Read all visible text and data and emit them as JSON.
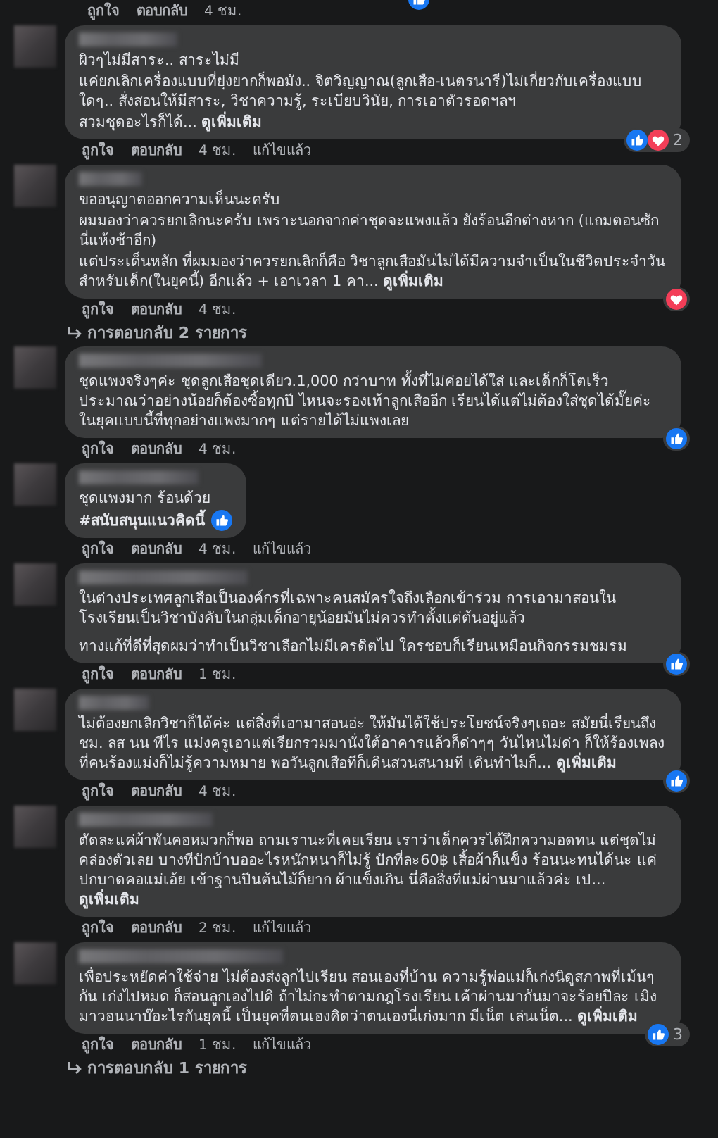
{
  "top_actions": {
    "like": "ถูกใจ",
    "reply": "ตอบกลับ",
    "time": "4 ชม.",
    "reactions": [
      {
        "kind": "like"
      }
    ]
  },
  "comments": [
    {
      "paragraphs": [
        "ผิวๆไม่มีสาระ.. สาระไม่มี",
        "แค่ยกเลิกเครื่องแบบที่ยุ่งยากก็พอมัง.. จิตวิญญาณ(ลูกเสือ-เนตรนารี)ไม่เกี่ยวกับเครื่องแบบใดๆ.. สั่งสอนให้มีสาระ, วิชาความรู้, ระเบียบวินัย, การเอาตัวรอดฯลฯ",
        "สวมชุดอะไรก็ได้..."
      ],
      "see_more": "ดูเพิ่มเติม",
      "reactions": [
        {
          "kind": "like"
        },
        {
          "kind": "love"
        }
      ],
      "reaction_count": "2",
      "like": "ถูกใจ",
      "reply": "ตอบกลับ",
      "time": "4 ชม.",
      "edited": "แก้ไขแล้ว"
    },
    {
      "paragraphs": [
        "ขออนุญาตออกความเห็นนะครับ",
        "ผมมองว่าควรยกเลิกนะครับ เพราะนอกจากค่าชุดจะแพงแล้ว ยังร้อนอีกต่างหาก (แถมตอนซักนี่แห้งช้าอีก)",
        "แต่ประเด็นหลัก ที่ผมมองว่าควรยกเลิกก็คือ วิชาลูกเสือมันไม่ได้มีความจำเป็นในชีวิตประจำวันสำหรับเด็ก(ในยุคนี้) อีกแล้ว + เอาเวลา 1 คา..."
      ],
      "see_more": "ดูเพิ่มเติม",
      "reactions": [
        {
          "kind": "love"
        }
      ],
      "like": "ถูกใจ",
      "reply": "ตอบกลับ",
      "time": "4 ชม.",
      "replies": "การตอบกลับ 2 รายการ"
    },
    {
      "paragraphs": [
        "ชุดแพงจริงๆค่ะ ชุดลูกเสือชุดเดียว.1,000 กว่าบาท ทั้งที่ไม่ค่อยได้ใส่ และเด็กก็โตเร็วประมาณว่าอย่างน้อยก็ต้องซื้อทุกปี ไหนจะรองเท้าลูกเสืออีก เรียนได้แต่ไม่ต้องใส่ชุดได้มั๊ยค่ะ ในยุคแบบนี้ที่ทุกอย่างแพงมากๆ แต่รายได้ไม่แพงเลย"
      ],
      "reactions": [
        {
          "kind": "like"
        }
      ],
      "like": "ถูกใจ",
      "reply": "ตอบกลับ",
      "time": "4 ชม."
    },
    {
      "paragraphs": [
        "ชุดแพงมาก ร้อนด้วย"
      ],
      "hashtag": "#สนับสนุนแนวคิดนี้",
      "reactions": [
        {
          "kind": "like"
        }
      ],
      "like": "ถูกใจ",
      "reply": "ตอบกลับ",
      "time": "4 ชม.",
      "edited": "แก้ไขแล้ว"
    },
    {
      "paragraphs": [
        "ในต่างประเทศลูกเสือเป็นองค์กรที่เฉพาะคนสมัครใจถึงเลือกเข้าร่วม การเอามาสอนในโรงเรียนเป็นวิชาบังคับในกลุ่มเด็กอายุน้อยมันไม่ควรทำตั้งแต่ต้นอยู่แล้ว",
        "ทางแก้ที่ดีที่สุดผมว่าทำเป็นวิชาเลือกไม่มีเครดิตไป ใครชอบก็เรียนเหมือนกิจกรรมชมรม"
      ],
      "reactions": [
        {
          "kind": "like"
        }
      ],
      "like": "ถูกใจ",
      "reply": "ตอบกลับ",
      "time": "1 ชม."
    },
    {
      "paragraphs": [
        "ไม่ต้องยกเลิกวิชาก็ได้ค่ะ แต่สิ่งที่เอามาสอนอ่ะ ให้มันได้ใช้ประโยชน์จริงๆเถอะ สมัยนี่เรียนถึงชม. ลส นน ทีไร แม่งครูเอาแต่เรียกรวมมานั่งใต้อาคารแล้วก็ด่าๆๆ วันไหนไม่ด่า ก็ให้ร้องเพลงที่คนร้องแม่งก็ไม่รู้ความหมาย พอวันลูกเสือทีก็เดินสวนสนามที เดินทำไมก็..."
      ],
      "see_more": "ดูเพิ่มเติม",
      "reactions": [
        {
          "kind": "like"
        }
      ],
      "like": "ถูกใจ",
      "reply": "ตอบกลับ",
      "time": "4 ชม."
    },
    {
      "paragraphs": [
        "ตัดละแค่ผ้าพันคอหมวกก็พอ ถามเรานะที่เคยเรียน เราว่าเด็กควรได้ฝึกความอดทน แต่ชุดไม่คล่องตัวเลย บางทีปักบ้าบออะไรหนักหนาก็ไม่รู้ ปักที่ละ60฿ เสื้อผ้าก็แข็ง ร้อนนะทนได้นะ แค่ปกบาดคอแม่เอ้ย เข้าฐานปีนต้นไม้ก็ยาก ผ้าแข็งเกิน นี่คือสิ่งที่แม่ผ่านมาแล้วค่ะ เป..."
      ],
      "see_more": "ดูเพิ่มเติม",
      "like": "ถูกใจ",
      "reply": "ตอบกลับ",
      "time": "2 ชม.",
      "edited": "แก้ไขแล้ว"
    },
    {
      "paragraphs": [
        "เพื่อประหยัดค่าใช้จ่าย ไม่ต้องส่งลูกไปเรียน สอนเองที่บ้าน ความรู้พ่อแม่ก็เก่งนิดูสภาพที่เม้นๆกัน เก่งไปหมด ก็สอนลูกเองไปดิ ถ้าไม่กะทำตามกฎโรงเรียน เค้าผ่านมากันมาจะร้อยปีละ เมิงมาวอนนาบ๊อะไรกันยุคนี้ เป็นยุคที่ตนเองคิดว่าตนเองนี่เก่งมาก มีเน็ต เล่นเน็ต..."
      ],
      "see_more": "ดูเพิ่มเติม",
      "reactions": [
        {
          "kind": "like"
        }
      ],
      "reaction_count": "3",
      "like": "ถูกใจ",
      "reply": "ตอบกลับ",
      "time": "1 ชม.",
      "edited": "แก้ไขแล้ว",
      "replies": "การตอบกลับ 1 รายการ"
    }
  ]
}
